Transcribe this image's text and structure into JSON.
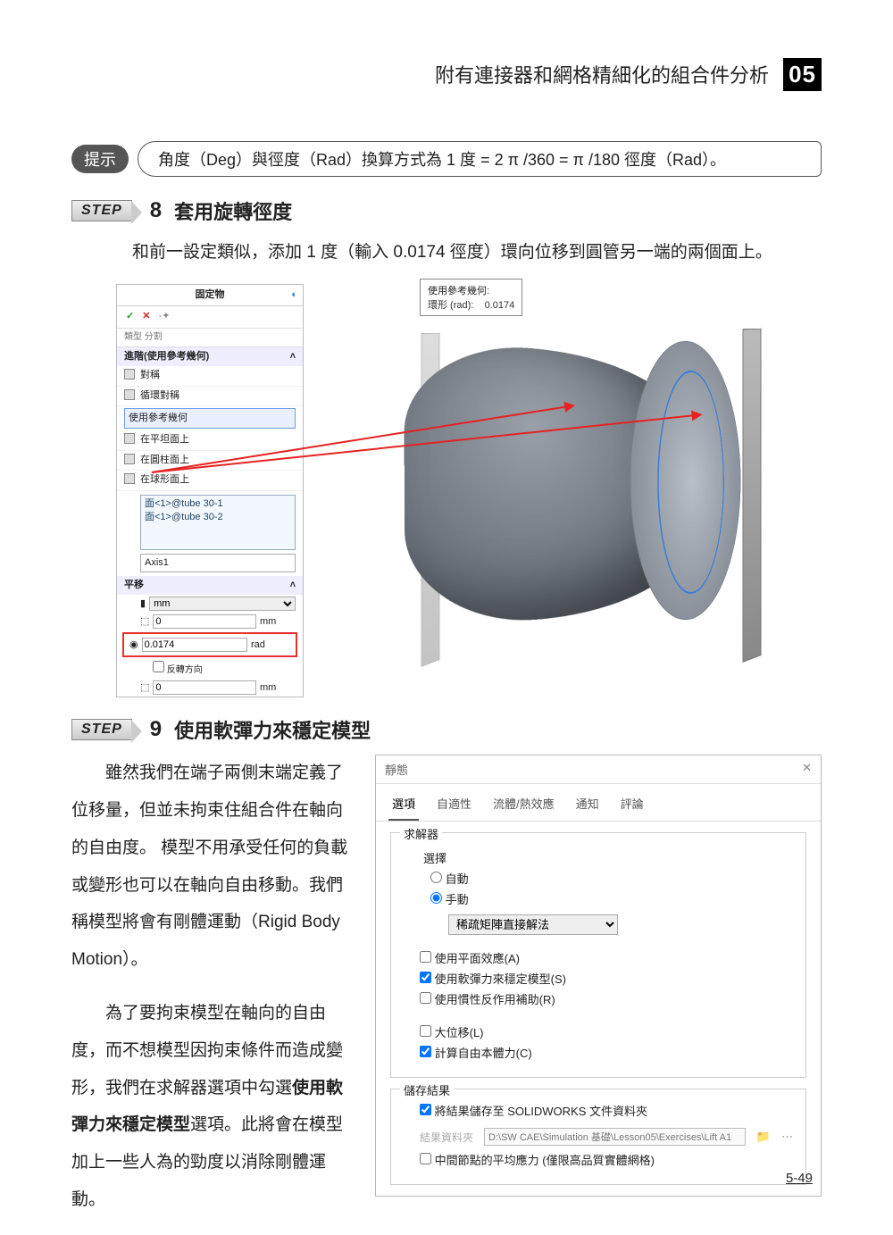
{
  "header": {
    "title": "附有連接器和網格精細化的組合件分析",
    "chapter": "05"
  },
  "hint": {
    "label": "提示",
    "text": "角度（Deg）與徑度（Rad）換算方式為 1 度 = 2 π /360 =  π /180 徑度（Rad）。"
  },
  "step8": {
    "label": "STEP",
    "num": "8",
    "title": "套用旋轉徑度",
    "body": "和前一設定類似，添加 1 度（輸入 0.0174 徑度）環向位移到圓管另一端的兩個面上。",
    "panel": {
      "title": "固定物",
      "tabs": "類型 分割",
      "section1": "進階(使用參考幾何)",
      "tree": [
        "對稱",
        "循環對稱",
        "使用參考幾何",
        "在平坦面上",
        "在圓柱面上",
        "在球形面上"
      ],
      "selected": [
        "面<1>@tube 30-1",
        "面<1>@tube 30-2"
      ],
      "axis": "Axis1",
      "section2": "平移",
      "unit": "mm",
      "row1": {
        "value": "0",
        "unit": "mm"
      },
      "row2": {
        "value": "0.0174",
        "unit": "rad"
      },
      "reverse": "反轉方向",
      "row3": {
        "value": "0",
        "unit": "mm"
      }
    },
    "tooltip": {
      "line1": "使用參考幾何:",
      "label": "環形 (rad):",
      "value": "0.0174"
    }
  },
  "step9": {
    "label": "STEP",
    "num": "9",
    "title": "使用軟彈力來穩定模型",
    "para1": "雖然我們在端子兩側末端定義了位移量，但並未拘束住組合件在軸向的自由度。 模型不用承受任何的負載或變形也可以在軸向自由移動。我們稱模型將會有剛體運動（Rigid Body Motion）。",
    "para2_a": "為了要拘束模型在軸向的自由度，而不想模型因拘束條件而造成變形，我們在求解器選項中勾選",
    "para2_bold": "使用軟彈力來穩定模型",
    "para2_b": "選項。此將會在模型加上一些人為的勁度以消除剛體運動。",
    "dialog": {
      "title": "靜態",
      "tabs": [
        "選項",
        "自適性",
        "流體/熱效應",
        "通知",
        "評論"
      ],
      "active_tab": "選項",
      "group_solver": "求解器",
      "sub_select": "選擇",
      "radio_auto": "自動",
      "radio_manual": "手動",
      "solver_option": "稀疏矩陣直接解法",
      "chk_plane": "使用平面效應(A)",
      "chk_soft": "使用軟彈力來穩定模型(S)",
      "chk_inertia": "使用慣性反作用補助(R)",
      "chk_large": "大位移(L)",
      "chk_freebody": "計算自由本體力(C)",
      "group_save": "儲存結果",
      "chk_savefolder": "將結果儲存至 SOLIDWORKS 文件資料夾",
      "path_label": "結果資料夾",
      "path_value": "D:\\SW CAE\\Simulation 基礎\\Lesson05\\Exercises\\Lift A1",
      "chk_midnode": "中間節點的平均應力 (僅限高品質實體網格)"
    }
  },
  "footer": "5-49"
}
